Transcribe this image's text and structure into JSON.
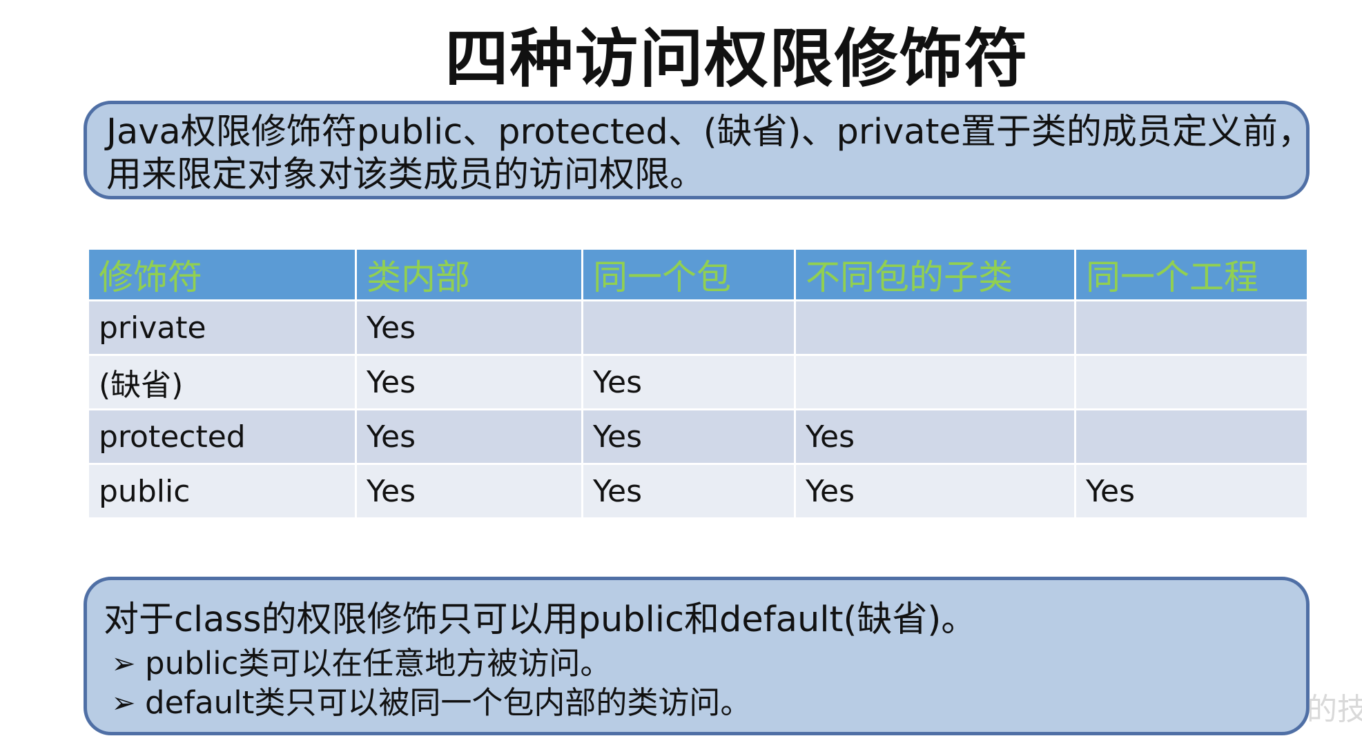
{
  "slide": {
    "title": "四种访问权限修饰符"
  },
  "intro": {
    "line1": "Java权限修饰符public、protected、(缺省)、private置于类的成员定义前，",
    "line2": "用来限定对象对该类成员的访问权限。"
  },
  "table": {
    "headers": [
      "修饰符",
      "类内部",
      "同一个包",
      "不同包的子类",
      "同一个工程"
    ],
    "rows": [
      [
        "private",
        "Yes",
        "",
        "",
        ""
      ],
      [
        "(缺省)",
        "Yes",
        "Yes",
        "",
        ""
      ],
      [
        "protected",
        "Yes",
        "Yes",
        "Yes",
        ""
      ],
      [
        "public",
        "Yes",
        "Yes",
        "Yes",
        "Yes"
      ]
    ]
  },
  "class_note": {
    "summary": "对于class的权限修饰只可以用public和default(缺省)。",
    "bullet_icon": "arrow-bullet-icon",
    "bullets": [
      "public类可以在任意地方被访问。",
      "default类只可以被同一个包内部的类访问。"
    ]
  },
  "watermark": "的技",
  "colors": {
    "box_fill": "#b8cce4",
    "box_border": "#4f6fa5",
    "header_fill": "#5b9bd5",
    "header_text": "#92d050",
    "row_odd": "#d0d8e8",
    "row_even": "#e9edf4"
  }
}
